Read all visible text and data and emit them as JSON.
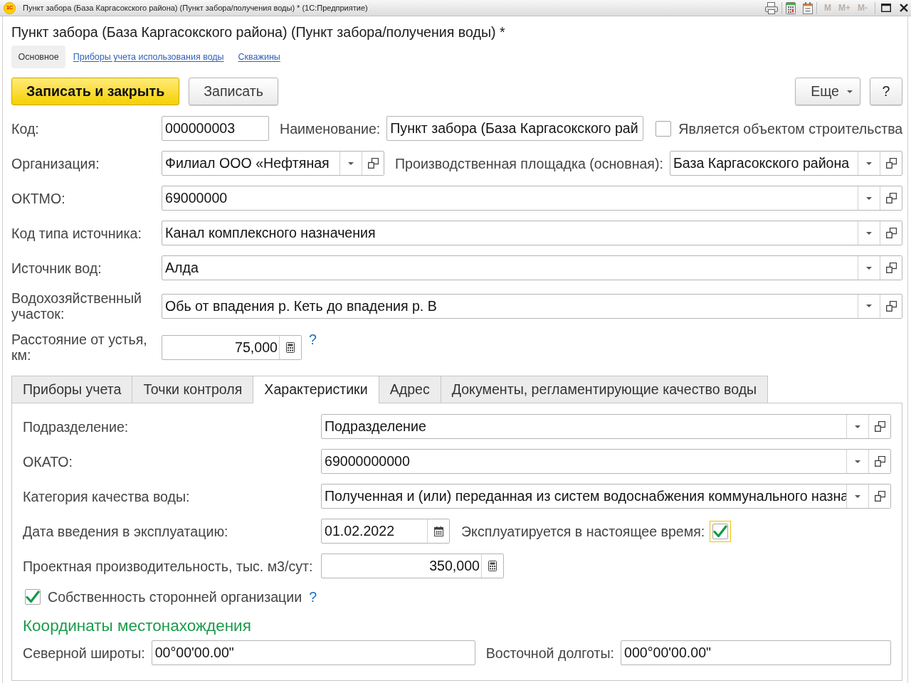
{
  "window": {
    "logo": "1С",
    "title": "Пункт забора (База Каргасокского района) (Пункт забора/получения воды) * (1С:Предприятие)",
    "memory_buttons": [
      {
        "label": "M",
        "disabled": true
      },
      {
        "label": "M+",
        "disabled": true
      },
      {
        "label": "M-",
        "disabled": true
      }
    ]
  },
  "form_title": "Пункт забора (База Каргасокского района) (Пункт забора/получения воды) *",
  "nav": [
    {
      "label": "Основное",
      "selected": true
    },
    {
      "label": "Приборы учета использования воды",
      "selected": false
    },
    {
      "label": "Скважины",
      "selected": false
    }
  ],
  "commands": [
    {
      "label": "Записать и закрыть",
      "kind": "default"
    },
    {
      "label": "Записать",
      "kind": "normal"
    }
  ],
  "more_menu": {
    "label": "Еще"
  },
  "help_button": {
    "label": "?"
  },
  "fields": [
    {
      "items": [
        {
          "kind": "text",
          "label": "Код:",
          "value": "000000003"
        },
        {
          "kind": "text",
          "label": "Наименование:",
          "value": "Пункт забора (База Каргасокского рай"
        },
        {
          "kind": "checkbox",
          "label": "Является объектом строительства",
          "checked": false
        }
      ]
    },
    {
      "items": [
        {
          "kind": "select",
          "label": "Организация:",
          "value": "Филиал ООО «Нефтяная"
        },
        {
          "kind": "select",
          "label": "Производственная площадка (основная):",
          "value": "База Каргасокского района"
        }
      ]
    },
    {
      "items": [
        {
          "kind": "select",
          "label": "ОКТМО:",
          "value": "69000000"
        }
      ]
    },
    {
      "items": [
        {
          "kind": "select",
          "label": "Код типа источника:",
          "value": "Канал комплексного назначения"
        }
      ]
    },
    {
      "items": [
        {
          "kind": "select",
          "label": "Источник вод:",
          "value": "Алда"
        }
      ]
    },
    {
      "items": [
        {
          "kind": "select",
          "label": "Водохозяйственный участок:",
          "value": "Обь от впадения р. Кеть до впадения р. В"
        }
      ]
    },
    {
      "items": [
        {
          "kind": "number",
          "label": "Расстояние от устья, км:",
          "value": "75,000",
          "help": "?"
        }
      ]
    }
  ],
  "tabs": [
    {
      "label": "Приборы учета",
      "selected": false
    },
    {
      "label": "Точки контроля",
      "selected": false
    },
    {
      "label": "Характеристики",
      "selected": true
    },
    {
      "label": "Адрес",
      "selected": false
    },
    {
      "label": "Документы, регламентирующие качество воды",
      "selected": false
    }
  ],
  "characteristics": {
    "fields": [
      {
        "kind": "select",
        "label": "Подразделение:",
        "value": "Подразделение"
      },
      {
        "kind": "select",
        "label": "ОКАТО:",
        "value": "69000000000"
      },
      {
        "kind": "select",
        "label": "Категория качества воды:",
        "value": "Полученная и (или) переданная из систем водоснабжения коммунального назна"
      },
      {
        "kind": "date",
        "label": "Дата введения в эксплуатацию:",
        "value": "01.02.2022",
        "flag": {
          "label": "Эксплуатируется в настоящее время:",
          "checked": true,
          "focused": true
        }
      },
      {
        "kind": "number",
        "label": "Проектная производительность, тыс. м3/сут:",
        "value": "350,000"
      }
    ],
    "ownership": {
      "label": "Собственность сторонней организации",
      "checked": true,
      "help": "?"
    },
    "section_title": "Координаты местонахождения",
    "coordinates": [
      {
        "kind": "text",
        "label": "Северной широты:",
        "value": "00°00'00.00\""
      },
      {
        "kind": "text",
        "label": "Восточной долготы:",
        "value": "000°00'00.00\""
      }
    ]
  }
}
